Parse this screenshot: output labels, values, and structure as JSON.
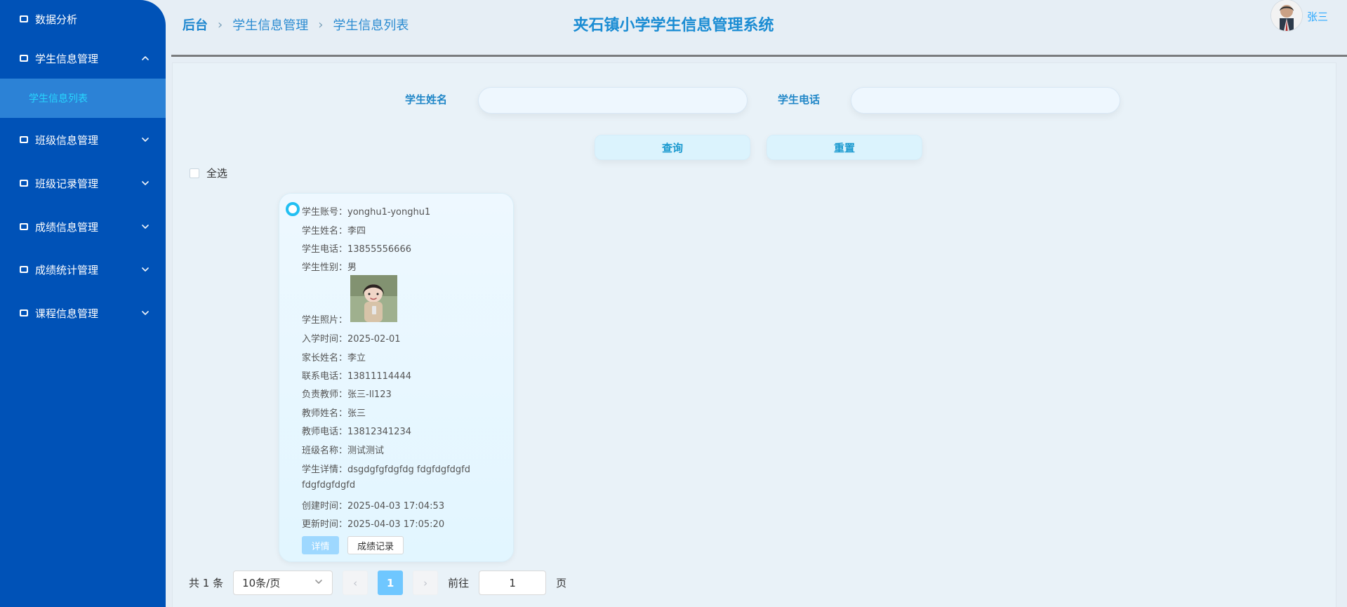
{
  "sidebar": {
    "items": [
      {
        "label": "数据分析"
      },
      {
        "label": "学生信息管理"
      },
      {
        "label": "学生信息列表"
      },
      {
        "label": "班级信息管理"
      },
      {
        "label": "班级记录管理"
      },
      {
        "label": "成绩信息管理"
      },
      {
        "label": "成绩统计管理"
      },
      {
        "label": "课程信息管理"
      }
    ]
  },
  "header": {
    "breadcrumb": [
      "后台",
      "学生信息管理",
      "学生信息列表"
    ],
    "title": "夹石镇小学学生信息管理系统",
    "user_name": "张三"
  },
  "search": {
    "student_name_label": "学生姓名",
    "student_phone_label": "学生电话",
    "query_button": "查询",
    "reset_button": "重置"
  },
  "list": {
    "select_all": "全选"
  },
  "card": {
    "fields": [
      {
        "k": "学生账号：",
        "v": "yonghu1-yonghu1"
      },
      {
        "k": "学生姓名：",
        "v": "李四"
      },
      {
        "k": "学生电话：",
        "v": "13855556666"
      },
      {
        "k": "学生性别：",
        "v": "男"
      },
      {
        "k": "学生照片：",
        "v": ""
      },
      {
        "k": "入学时间：",
        "v": "2025-02-01"
      },
      {
        "k": "家长姓名：",
        "v": "李立"
      },
      {
        "k": "联系电话：",
        "v": "13811114444"
      },
      {
        "k": "负责教师：",
        "v": "张三-ll123"
      },
      {
        "k": "教师姓名：",
        "v": "张三"
      },
      {
        "k": "教师电话：",
        "v": "13812341234"
      },
      {
        "k": "班级名称：",
        "v": "测试测试"
      },
      {
        "k": "学生详情：",
        "v": "dsgdgfgfdgfdg fdgfdgfdgfd"
      },
      {
        "k": "",
        "v": "fdgfdgfdgfd"
      },
      {
        "k": "创建时间：",
        "v": "2025-04-03 17:04:53"
      },
      {
        "k": "更新时间：",
        "v": "2025-04-03 17:05:20"
      }
    ],
    "buttons": {
      "detail": "详情",
      "grades": "成绩记录"
    }
  },
  "pagination": {
    "total": "共 1 条",
    "page_size": "10条/页",
    "current_page": "1",
    "goto_label": "前往",
    "goto_value": "1",
    "page_suffix": "页"
  }
}
